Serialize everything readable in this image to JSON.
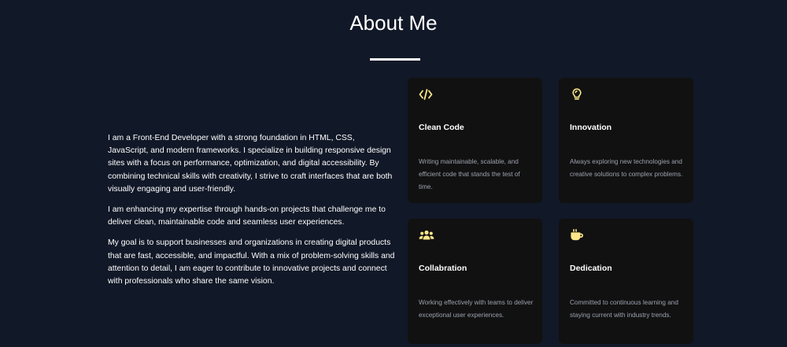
{
  "section": {
    "title": "About Me"
  },
  "about": {
    "paragraphs": [
      "I am a Front-End Developer with a strong foundation in HTML, CSS, JavaScript, and modern frameworks. I specialize in building responsive design sites with a focus on performance, optimization, and digital accessibility. By combining technical skills with creativity, I strive to craft interfaces that are both visually engaging and user-friendly.",
      "I am enhancing my expertise through hands-on projects that challenge me to deliver clean, maintainable code and seamless user experiences.",
      "My goal is to support businesses and organizations in creating digital products that are fast, accessible, and impactful. With a mix of problem-solving skills and attention to detail, I am eager to contribute to innovative projects and connect with professionals who share the same vision."
    ]
  },
  "cards": [
    {
      "icon": "code-icon",
      "title": "Clean Code",
      "description": "Writing maintainable, scalable, and efficient code that stands the test of time."
    },
    {
      "icon": "lightbulb-icon",
      "title": "Innovation",
      "description": "Always exploring new technologies and creative solutions to complex problems."
    },
    {
      "icon": "users-icon",
      "title": "Collabration",
      "description": "Working effectively with teams to deliver exceptional user experiences."
    },
    {
      "icon": "coffee-icon",
      "title": "Dedication",
      "description": "Committed to continuous learning and staying current with industry trends."
    }
  ],
  "colors": {
    "background": "#111827",
    "card_background": "#111111",
    "accent_icon": "#fde68a",
    "muted_text": "#9ca3af"
  }
}
